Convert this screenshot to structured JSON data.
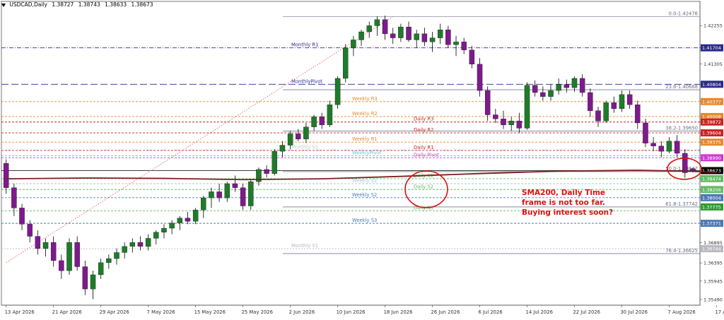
{
  "header": {
    "symbol": "USDCAD,Daily",
    "open": "1.38727",
    "high": "1.38743",
    "low": "1.38633",
    "close": "1.38673"
  },
  "colors": {
    "bull": "#1e7b2a",
    "bear": "#7d1a8c",
    "sma": "#7a1f1f",
    "pivot_red": "#cc2222",
    "weekly_orange": "#e6882e",
    "weekly_blue": "#4a7ab5",
    "daily_green": "#66bb66",
    "magenta": "#d23ad2",
    "navy": "#2a2a8c",
    "fib": "#5a5a8a",
    "annotation": "#dd1111"
  },
  "chart_data": {
    "type": "candlestick",
    "symbol": "USDCAD",
    "timeframe": "Daily",
    "ylim": [
      1.3535,
      1.4285
    ],
    "y_ticks": [
      "1.42255",
      "1.41704",
      "1.41305",
      "1.40804",
      "1.40377",
      "1.40008",
      "1.39872",
      "1.39604",
      "1.39375",
      "1.38990",
      "1.38673",
      "1.38474",
      "1.38206",
      "1.38004",
      "1.37775",
      "1.37371",
      "1.36895",
      "1.36395",
      "1.35945",
      "1.35490"
    ],
    "x_labels": [
      {
        "i": 0,
        "label": "13 Apr 2026"
      },
      {
        "i": 6,
        "label": "21 Apr 2026"
      },
      {
        "i": 12,
        "label": "29 Apr 2026"
      },
      {
        "i": 18,
        "label": "7 May 2026"
      },
      {
        "i": 24,
        "label": "15 May 2026"
      },
      {
        "i": 30,
        "label": "25 May 2026"
      },
      {
        "i": 36,
        "label": "2 Jun 2026"
      },
      {
        "i": 42,
        "label": "10 Jun 2026"
      },
      {
        "i": 48,
        "label": "18 Jun 2026"
      },
      {
        "i": 54,
        "label": "26 Jun 2026"
      },
      {
        "i": 60,
        "label": "6 Jul 2026"
      },
      {
        "i": 66,
        "label": "14 Jul 2026"
      },
      {
        "i": 72,
        "label": "22 Jul 2026"
      },
      {
        "i": 78,
        "label": "30 Jul 2026"
      },
      {
        "i": 84,
        "label": "7 Aug 2026"
      },
      {
        "i": 90,
        "label": "17 Aug 2026"
      }
    ],
    "candles": [
      [
        1.3885,
        1.3895,
        1.381,
        1.3825
      ],
      [
        1.3825,
        1.3835,
        1.3755,
        1.3775
      ],
      [
        1.3775,
        1.3785,
        1.372,
        1.3735
      ],
      [
        1.3735,
        1.3745,
        1.369,
        1.3705
      ],
      [
        1.3705,
        1.372,
        1.366,
        1.3675
      ],
      [
        1.3675,
        1.37,
        1.3655,
        1.369
      ],
      [
        1.369,
        1.3705,
        1.363,
        1.3645
      ],
      [
        1.3645,
        1.366,
        1.36,
        1.362
      ],
      [
        1.362,
        1.37,
        1.361,
        1.369
      ],
      [
        1.369,
        1.3705,
        1.362,
        1.363
      ],
      [
        1.363,
        1.3645,
        1.356,
        1.3575
      ],
      [
        1.3575,
        1.362,
        1.355,
        1.361
      ],
      [
        1.361,
        1.365,
        1.36,
        1.364
      ],
      [
        1.364,
        1.366,
        1.3625,
        1.365
      ],
      [
        1.365,
        1.3675,
        1.3635,
        1.3665
      ],
      [
        1.3665,
        1.369,
        1.365,
        1.368
      ],
      [
        1.368,
        1.37,
        1.3665,
        1.369
      ],
      [
        1.369,
        1.3705,
        1.367,
        1.368
      ],
      [
        1.368,
        1.371,
        1.367,
        1.37
      ],
      [
        1.37,
        1.372,
        1.3685,
        1.3715
      ],
      [
        1.3715,
        1.3735,
        1.37,
        1.3725
      ],
      [
        1.3725,
        1.3745,
        1.371,
        1.3738
      ],
      [
        1.3738,
        1.3755,
        1.372,
        1.375
      ],
      [
        1.375,
        1.3765,
        1.3735,
        1.3742
      ],
      [
        1.3742,
        1.3775,
        1.3735,
        1.377
      ],
      [
        1.377,
        1.3805,
        1.375,
        1.38
      ],
      [
        1.38,
        1.3825,
        1.3775,
        1.3815
      ],
      [
        1.3815,
        1.3835,
        1.379,
        1.38
      ],
      [
        1.38,
        1.384,
        1.379,
        1.3835
      ],
      [
        1.3835,
        1.3855,
        1.3815,
        1.3825
      ],
      [
        1.3825,
        1.3835,
        1.377,
        1.378
      ],
      [
        1.378,
        1.3845,
        1.377,
        1.384
      ],
      [
        1.384,
        1.3875,
        1.383,
        1.387
      ],
      [
        1.387,
        1.388,
        1.385,
        1.386
      ],
      [
        1.386,
        1.392,
        1.3855,
        1.3915
      ],
      [
        1.3915,
        1.394,
        1.39,
        1.393
      ],
      [
        1.393,
        1.3965,
        1.392,
        1.3958
      ],
      [
        1.3958,
        1.397,
        1.394,
        1.3945
      ],
      [
        1.3945,
        1.3985,
        1.3935,
        1.3975
      ],
      [
        1.3975,
        1.4005,
        1.3965,
        1.4
      ],
      [
        1.4,
        1.401,
        1.397,
        1.398
      ],
      [
        1.398,
        1.404,
        1.3975,
        1.403
      ],
      [
        1.403,
        1.41,
        1.402,
        1.4095
      ],
      [
        1.4095,
        1.418,
        1.4085,
        1.417
      ],
      [
        1.417,
        1.42,
        1.415,
        1.419
      ],
      [
        1.419,
        1.4215,
        1.4175,
        1.421
      ],
      [
        1.421,
        1.4235,
        1.4195,
        1.4225
      ],
      [
        1.4225,
        1.4248,
        1.42,
        1.424
      ],
      [
        1.424,
        1.425,
        1.419,
        1.4205
      ],
      [
        1.4205,
        1.422,
        1.418,
        1.4195
      ],
      [
        1.4195,
        1.423,
        1.4185,
        1.4222
      ],
      [
        1.4222,
        1.4235,
        1.4185,
        1.419
      ],
      [
        1.419,
        1.4215,
        1.417,
        1.4205
      ],
      [
        1.4205,
        1.422,
        1.4175,
        1.4185
      ],
      [
        1.4185,
        1.421,
        1.416,
        1.4195
      ],
      [
        1.4195,
        1.423,
        1.418,
        1.4215
      ],
      [
        1.4215,
        1.4225,
        1.417,
        1.4178
      ],
      [
        1.4178,
        1.42,
        1.415,
        1.4185
      ],
      [
        1.4185,
        1.4195,
        1.4155,
        1.4165
      ],
      [
        1.4165,
        1.4175,
        1.412,
        1.413
      ],
      [
        1.413,
        1.4145,
        1.405,
        1.4065
      ],
      [
        1.4065,
        1.4075,
        1.399,
        1.4005
      ],
      [
        1.4005,
        1.402,
        1.3985,
        1.3995
      ],
      [
        1.3995,
        1.4015,
        1.397,
        1.398
      ],
      [
        1.398,
        1.4,
        1.3965,
        1.399
      ],
      [
        1.399,
        1.401,
        1.396,
        1.3972
      ],
      [
        1.3972,
        1.4085,
        1.3968,
        1.4078
      ],
      [
        1.4078,
        1.409,
        1.405,
        1.406
      ],
      [
        1.406,
        1.4075,
        1.404,
        1.405
      ],
      [
        1.405,
        1.408,
        1.404,
        1.4065
      ],
      [
        1.4065,
        1.4095,
        1.4055,
        1.408
      ],
      [
        1.408,
        1.4092,
        1.406,
        1.4072
      ],
      [
        1.4072,
        1.41,
        1.4062,
        1.4095
      ],
      [
        1.4095,
        1.4105,
        1.405,
        1.406
      ],
      [
        1.406,
        1.407,
        1.4,
        1.4015
      ],
      [
        1.4015,
        1.4025,
        1.3975,
        1.399
      ],
      [
        1.399,
        1.404,
        1.3985,
        1.4035
      ],
      [
        1.4035,
        1.405,
        1.401,
        1.402
      ],
      [
        1.402,
        1.4065,
        1.4012,
        1.4055
      ],
      [
        1.4055,
        1.4065,
        1.402,
        1.403
      ],
      [
        1.403,
        1.404,
        1.397,
        1.3985
      ],
      [
        1.3985,
        1.3995,
        1.3925,
        1.3935
      ],
      [
        1.3935,
        1.395,
        1.3915,
        1.3928
      ],
      [
        1.3928,
        1.394,
        1.39,
        1.3915
      ],
      [
        1.3915,
        1.395,
        1.391,
        1.394
      ],
      [
        1.394,
        1.3955,
        1.39,
        1.391
      ],
      [
        1.391,
        1.392,
        1.385,
        1.3862
      ],
      [
        1.3872,
        1.3874,
        1.3863,
        1.3867
      ]
    ],
    "sma200": {
      "name": "SMA200",
      "points": [
        [
          0,
          1.3847
        ],
        [
          10,
          1.3849
        ],
        [
          20,
          1.3848
        ],
        [
          30,
          1.3845
        ],
        [
          40,
          1.3847
        ],
        [
          50,
          1.3853
        ],
        [
          60,
          1.386
        ],
        [
          70,
          1.3866
        ],
        [
          80,
          1.3868
        ],
        [
          86,
          1.3866
        ],
        [
          90,
          1.3863
        ]
      ]
    },
    "levels": [
      {
        "name": "top",
        "value": 1.42476,
        "text": "0.0-1.42476",
        "side": "right",
        "color": "#9aa0b8",
        "dash": "",
        "label_color": "#6a6a8a"
      },
      {
        "name": "monthly-r1",
        "value": 1.41704,
        "text": "Monthly R1",
        "side": "monthly",
        "color": "#2a2a8c",
        "dash": "6,2,1,2",
        "box": "1.41704",
        "box_color": "#2a2a8c"
      },
      {
        "name": "fib-23",
        "value": 1.40668,
        "text": "23.6-1.40668",
        "side": "right",
        "color": "#7a7a9a",
        "dash": "",
        "label_color": "#6a6a8a"
      },
      {
        "name": "monthly-pivot",
        "value": 1.40804,
        "text": "MonthlyPivot",
        "side": "monthly",
        "color": "#2a2a8c",
        "dash": "10,4",
        "box": "1.40804",
        "box_color": "#2a2a8c"
      },
      {
        "name": "weekly-r3",
        "value": 1.40377,
        "text": "Weekly R3",
        "side": "weekly",
        "color": "#e6882e",
        "dash": "3,2",
        "box": "1.40377",
        "box_color": "#e6882e"
      },
      {
        "name": "weekly-r2",
        "value": 1.40008,
        "text": "Weekly R2",
        "side": "weekly",
        "color": "#e6882e",
        "dash": "3,2",
        "box": "1.40008",
        "box_color": "#e6882e"
      },
      {
        "name": "daily-r3",
        "value": 1.39872,
        "text": "Daily R3",
        "side": "daily",
        "color": "#cc2222",
        "dash": "3,2",
        "box": "1.39872",
        "box_color": "#cc2222"
      },
      {
        "name": "fib-38",
        "value": 1.3965,
        "text": "38.2-1.39650",
        "side": "right",
        "color": "#7a7a9a",
        "dash": "",
        "label_color": "#6a6a8a"
      },
      {
        "name": "daily-r2",
        "value": 1.39604,
        "text": "Daily R2",
        "side": "daily",
        "color": "#cc2222",
        "dash": "3,2",
        "box": "1.39604",
        "box_color": "#cc2222"
      },
      {
        "name": "weekly-r1",
        "value": 1.39375,
        "text": "Weekly R1",
        "side": "weekly",
        "color": "#e6882e",
        "dash": "3,2",
        "box": "1.39375",
        "box_color": "#e6882e"
      },
      {
        "name": "daily-r1",
        "value": 1.39172,
        "text": "Daily R1",
        "side": "daily",
        "color": "#cc2222",
        "dash": "3,2",
        "box": "",
        "box_color": "#cc2222"
      },
      {
        "name": "monthly-s1-upper",
        "value": 1.3918,
        "text": "Monthly S1",
        "side": "monthly",
        "color": "#c8c8d0",
        "dash": "2,2",
        "box": "",
        "box_color": "#c8c8d0"
      },
      {
        "name": "weekly-pivot",
        "value": 1.3904,
        "text": "WeeklyPivot",
        "side": "weekly",
        "color": "#5cc6e8",
        "dash": "3,2",
        "box": "",
        "box_color": "#5cc6e8"
      },
      {
        "name": "daily-pivot",
        "value": 1.3899,
        "text": "Daily Pivot",
        "side": "daily",
        "color": "#d23ad2",
        "dash": "3,2",
        "box": "1.38990",
        "box_color": "#d23ad2"
      },
      {
        "name": "fib-50",
        "value": 1.38647,
        "text": "50.0-1.38647",
        "side": "right",
        "color": "#888888",
        "dash": "",
        "label_color": "#6a6a8a"
      },
      {
        "name": "price",
        "value": 1.38673,
        "text": "",
        "side": "none",
        "color": "#222222",
        "dash": "",
        "box": "1.38673",
        "box_color": "#000000"
      },
      {
        "name": "daily-s1",
        "value": 1.38474,
        "text": "Daily S1",
        "side": "daily",
        "color": "#66bb66",
        "dash": "3,2",
        "box": "1.38474",
        "box_color": "#66bb66"
      },
      {
        "name": "weekly-s1",
        "value": 1.3835,
        "text": "Weekly S1",
        "side": "weekly",
        "color": "#9ec8e8",
        "dash": "3,2",
        "box": "",
        "box_color": "#9ec8e8"
      },
      {
        "name": "daily-s2",
        "value": 1.38206,
        "text": "Daily S2",
        "side": "daily",
        "color": "#66bb66",
        "dash": "3,2",
        "box": "1.38206",
        "box_color": "#66bb66"
      },
      {
        "name": "weekly-s2",
        "value": 1.38004,
        "text": "Weekly S2",
        "side": "weekly",
        "color": "#4a7ab5",
        "dash": "3,2",
        "box": "1.38004",
        "box_color": "#4a7ab5"
      },
      {
        "name": "fib-61",
        "value": 1.37775,
        "text": "61.8-1.37742",
        "side": "right",
        "color": "#7a7a9a",
        "dash": "",
        "label_color": "#6a6a8a",
        "box": "1.37775",
        "box_color": "#2e9e2e"
      },
      {
        "name": "daily-s3",
        "value": 1.3768,
        "text": "Daily S3",
        "side": "daily",
        "color": "#66bb66",
        "dash": "3,2",
        "box": "",
        "box_color": "#66bb66"
      },
      {
        "name": "weekly-s3",
        "value": 1.37371,
        "text": "Weekly S3",
        "side": "weekly",
        "color": "#4a7ab5",
        "dash": "3,2",
        "box": "1.37371",
        "box_color": "#4a7ab5"
      },
      {
        "name": "monthly-s1",
        "value": 1.36744,
        "text": "Monthly S1",
        "side": "monthly",
        "color": "#b8b8c0",
        "dash": "2,2",
        "box": "1.36744",
        "box_color": "#b8b8c0"
      },
      {
        "name": "fib-76",
        "value": 1.36625,
        "text": "76.4-1.36625",
        "side": "right",
        "color": "#7a7a9a",
        "dash": "",
        "label_color": "#6a6a8a"
      }
    ],
    "annotation": {
      "lines": [
        "SMA200, Daily Time",
        "frame is not too far.",
        "Buying interest soon?"
      ]
    }
  }
}
